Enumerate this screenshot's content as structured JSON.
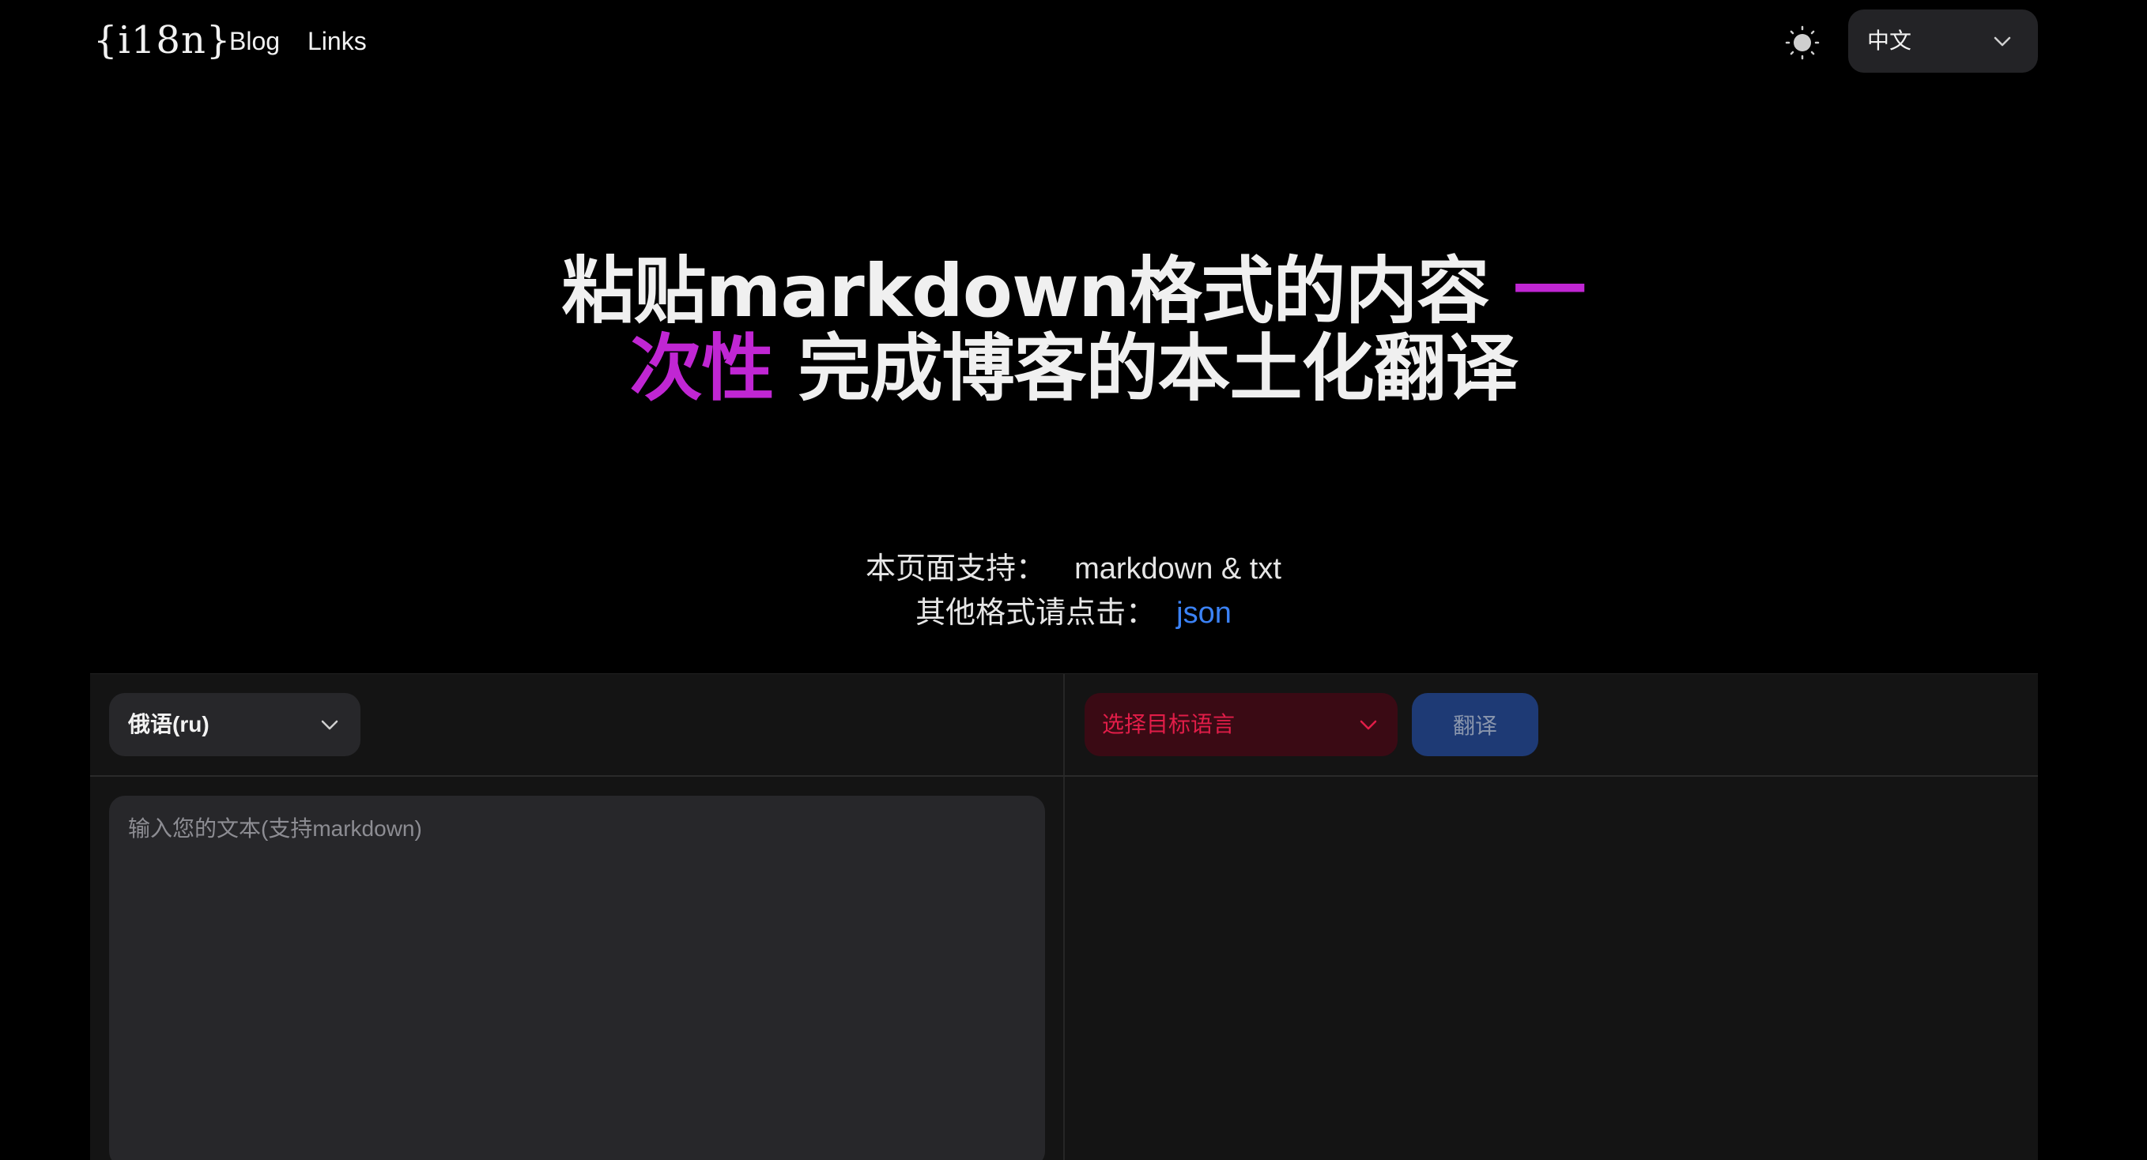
{
  "header": {
    "logo_text": "{i18n}",
    "nav": [
      {
        "label": "Blog"
      },
      {
        "label": "Links"
      }
    ],
    "theme_icon": "sun-icon",
    "ui_language": "中文"
  },
  "hero": {
    "title_part1": "粘贴markdown格式的内容 ",
    "title_accent": "一次性",
    "title_part2": " 完成博客的本土化翻译",
    "supported_label": "本页面支持：",
    "supported_value": "markdown & txt",
    "other_label": "其他格式请点击：",
    "other_link": "json"
  },
  "translator": {
    "source_language": "俄语(ru)",
    "target_language_placeholder": "选择目标语言",
    "translate_button": "翻译",
    "input_placeholder": "输入您的文本(支持markdown)",
    "input_value": ""
  },
  "colors": {
    "background": "#000000",
    "accent_purple": "#c026d3",
    "link_blue": "#3b82f6",
    "target_select_text": "#e11d48",
    "translate_button_bg": "#1e3a75"
  }
}
